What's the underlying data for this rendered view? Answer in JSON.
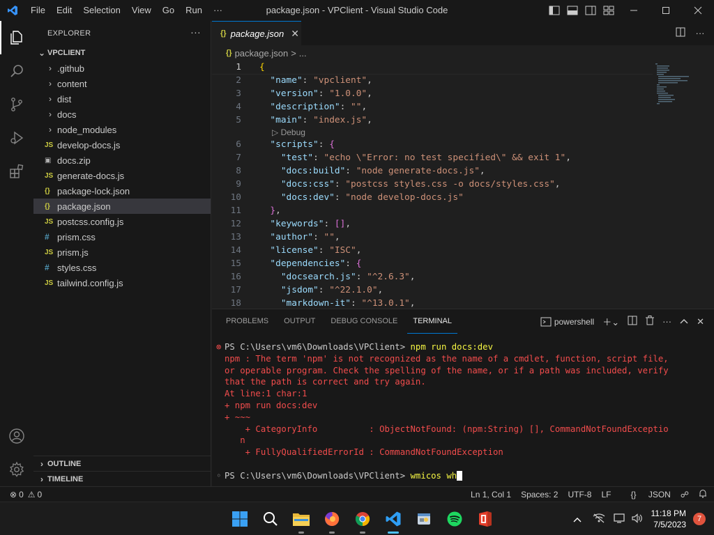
{
  "window": {
    "title": "package.json - VPClient - Visual Studio Code"
  },
  "menu": [
    "File",
    "Edit",
    "Selection",
    "View",
    "Go",
    "Run",
    "···"
  ],
  "activity_bar": {
    "top": [
      "explorer-icon",
      "search-icon",
      "source-control-icon",
      "run-debug-icon",
      "extensions-icon"
    ],
    "bottom": [
      "account-icon",
      "manage-gear-icon"
    ]
  },
  "sidebar": {
    "header": "EXPLORER",
    "more": "···",
    "root_folder": "VPCLIENT",
    "items": [
      {
        "label": ".github",
        "type": "folder",
        "icon": ""
      },
      {
        "label": "content",
        "type": "folder",
        "icon": ""
      },
      {
        "label": "dist",
        "type": "folder",
        "icon": ""
      },
      {
        "label": "docs",
        "type": "folder",
        "icon": ""
      },
      {
        "label": "node_modules",
        "type": "folder",
        "icon": ""
      },
      {
        "label": "develop-docs.js",
        "type": "file",
        "icon": "JS",
        "kind": "js"
      },
      {
        "label": "docs.zip",
        "type": "file",
        "icon": "▣",
        "kind": "zip"
      },
      {
        "label": "generate-docs.js",
        "type": "file",
        "icon": "JS",
        "kind": "js"
      },
      {
        "label": "package-lock.json",
        "type": "file",
        "icon": "{}",
        "kind": "json"
      },
      {
        "label": "package.json",
        "type": "file",
        "icon": "{}",
        "kind": "json",
        "selected": true
      },
      {
        "label": "postcss.config.js",
        "type": "file",
        "icon": "JS",
        "kind": "js"
      },
      {
        "label": "prism.css",
        "type": "file",
        "icon": "#",
        "kind": "css"
      },
      {
        "label": "prism.js",
        "type": "file",
        "icon": "JS",
        "kind": "js"
      },
      {
        "label": "styles.css",
        "type": "file",
        "icon": "#",
        "kind": "css"
      },
      {
        "label": "tailwind.config.js",
        "type": "file",
        "icon": "JS",
        "kind": "js"
      }
    ],
    "outline": "OUTLINE",
    "timeline": "TIMELINE"
  },
  "editor": {
    "tab": {
      "icon": "{}",
      "label": "package.json",
      "close": "✕"
    },
    "breadcrumb": {
      "icon": "{}",
      "file": "package.json",
      "sep": ">",
      "rest": "..."
    },
    "codelens": "Debug",
    "lines": [
      {
        "n": "1",
        "text": "{"
      },
      {
        "n": "2",
        "text": "  \"name\": \"vpclient\","
      },
      {
        "n": "3",
        "text": "  \"version\": \"1.0.0\","
      },
      {
        "n": "4",
        "text": "  \"description\": \"\","
      },
      {
        "n": "5",
        "text": "  \"main\": \"index.js\","
      },
      {
        "n": "6",
        "text": "  \"scripts\": {"
      },
      {
        "n": "7",
        "text": "    \"test\": \"echo \\\"Error: no test specified\\\" && exit 1\","
      },
      {
        "n": "8",
        "text": "    \"docs:build\": \"node generate-docs.js\","
      },
      {
        "n": "9",
        "text": "    \"docs:css\": \"postcss styles.css -o docs/styles.css\","
      },
      {
        "n": "10",
        "text": "    \"docs:dev\": \"node develop-docs.js\""
      },
      {
        "n": "11",
        "text": "  },"
      },
      {
        "n": "12",
        "text": "  \"keywords\": [],"
      },
      {
        "n": "13",
        "text": "  \"author\": \"\","
      },
      {
        "n": "14",
        "text": "  \"license\": \"ISC\","
      },
      {
        "n": "15",
        "text": "  \"dependencies\": {"
      },
      {
        "n": "16",
        "text": "    \"docsearch.js\": \"^2.6.3\","
      },
      {
        "n": "17",
        "text": "    \"jsdom\": \"^22.1.0\","
      },
      {
        "n": "18",
        "text": "    \"markdown-it\": \"^13.0.1\","
      }
    ]
  },
  "panel": {
    "tabs": [
      "PROBLEMS",
      "OUTPUT",
      "DEBUG CONSOLE",
      "TERMINAL"
    ],
    "active_tab": "TERMINAL",
    "shell": "powershell",
    "terminal": {
      "prompt1": "PS C:\\Users\\vm6\\Downloads\\VPClient> ",
      "command1": "npm run docs:dev",
      "error_lines": [
        "npm : The term 'npm' is not recognized as the name of a cmdlet, function, script file,",
        "or operable program. Check the spelling of the name, or if a path was included, verify",
        "that the path is correct and try again.",
        "At line:1 char:1",
        "+ npm run docs:dev",
        "+ ~~~",
        "    + CategoryInfo          : ObjectNotFound: (npm:String) [], CommandNotFoundExceptio",
        "   n",
        "    + FullyQualifiedErrorId : CommandNotFoundException"
      ],
      "prompt2": "PS C:\\Users\\vm6\\Downloads\\VPClient> ",
      "command2": "wmicos wh"
    }
  },
  "statusbar": {
    "errors": "0",
    "warnings": "0",
    "position": "Ln 1, Col 1",
    "spaces": "Spaces: 2",
    "encoding": "UTF-8",
    "eol": "LF",
    "language": "JSON"
  },
  "taskbar": {
    "apps": [
      "windows-start-icon",
      "search-icon",
      "file-explorer-icon",
      "firefox-icon",
      "chrome-icon",
      "vscode-icon",
      "weather-app-icon",
      "spotify-icon",
      "office-icon"
    ],
    "time": "11:18 PM",
    "date": "7/5/2023",
    "notifications": "7"
  },
  "colors": {
    "accent": "#0078d4",
    "error": "#f14c4c",
    "command": "#f5f543",
    "json_key": "#9cdcfe",
    "json_string": "#ce9178"
  }
}
